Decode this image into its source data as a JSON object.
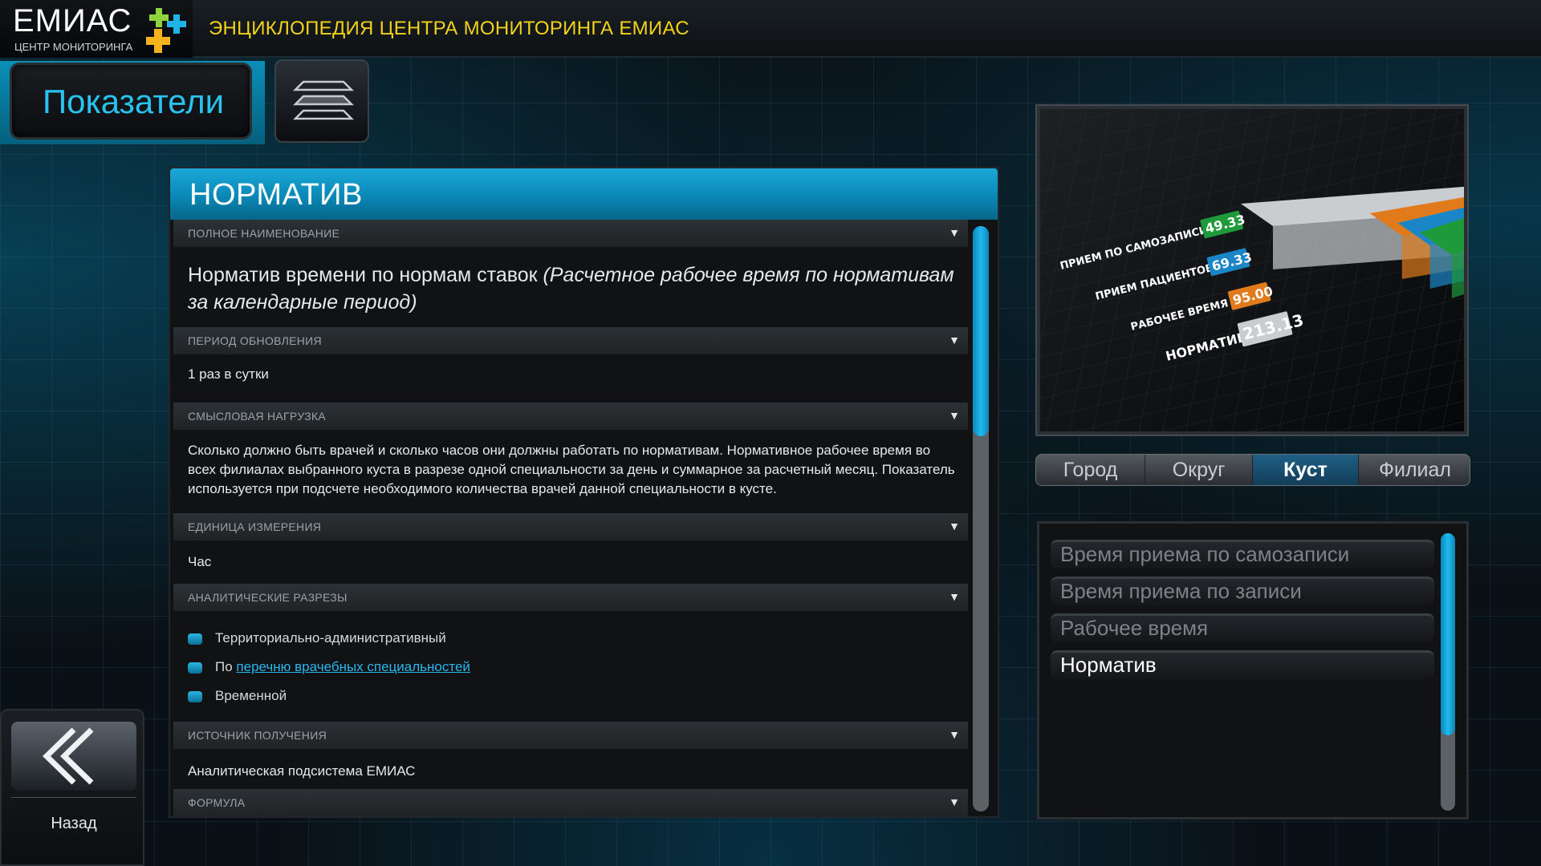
{
  "header": {
    "logo_text": "ЕМИАС",
    "logo_subtitle": "ЦЕНТР МОНИТОРИНГА",
    "title": "ЭНЦИКЛОПЕДИЯ ЦЕНТРА МОНИТОРИНГА ЕМИАС"
  },
  "nav": {
    "pokazateli_label": "Показатели",
    "menu_icon": "layers-icon",
    "back_label": "Назад",
    "back_icon": "double-chevron-left-icon"
  },
  "panel": {
    "title": "НОРМАТИВ",
    "sections": {
      "full_name": {
        "label": "ПОЛНОЕ НАИМЕНОВАНИЕ",
        "text_main": "Норматив времени по нормам ставок",
        "text_italic": "(Расчетное рабочее время по нормативам за календарные период)"
      },
      "update_period": {
        "label": "ПЕРИОД ОБНОВЛЕНИЯ",
        "text": "1 раз в сутки"
      },
      "meaning": {
        "label": "СМЫСЛОВАЯ НАГРУЗКА",
        "text": "Сколько должно быть врачей и сколько часов они должны работать по нормативам. Нормативное рабочее время во всех филиалах выбранного куста в разрезе одной специальности за день и суммарное за расчетный месяц. Показатель используется при подсчете необходимого количества врачей данной специальности в кусте."
      },
      "unit": {
        "label": "ЕДИНИЦА ИЗМЕРЕНИЯ",
        "text": "Час"
      },
      "slices": {
        "label": "АНАЛИТИЧЕСКИЕ РАЗРЕЗЫ",
        "items": {
          "first": "Территориально-административный",
          "second_prefix": "По",
          "second_link": "перечню врачебных специальностей",
          "third": "Временной"
        }
      },
      "source": {
        "label": "ИСТОЧНИК ПОЛУЧЕНИЯ",
        "text": "Аналитическая подсистема ЕМИАС"
      },
      "formula": {
        "label": "ФОРМУЛА"
      }
    }
  },
  "preview_chart": {
    "type": "bar",
    "categories": [
      "ПРИЕМ ПО САМОЗАПИСИ",
      "ПРИЕМ ПАЦИЕНТОВ",
      "РАБОЧЕЕ ВРЕМЯ",
      "НОРМАТИВ"
    ],
    "values": [
      49.33,
      69.33,
      95.0,
      213.13
    ],
    "value_labels": [
      "49.33",
      "69.33",
      "95.00",
      "213.13"
    ],
    "colors": [
      "#1f9a3a",
      "#1a86c8",
      "#e07a1a",
      "#c9cdd0"
    ]
  },
  "segments": {
    "items": {
      "city": "Город",
      "district": "Округ",
      "cluster": "Куст",
      "branch": "Филиал"
    },
    "active": "Куст"
  },
  "indicator_list": {
    "items": {
      "self_record": "Время приема по самозаписи",
      "record": "Время приема по записи",
      "work_time": "Рабочее время",
      "norm": "Норматив"
    },
    "active": "Норматив"
  }
}
